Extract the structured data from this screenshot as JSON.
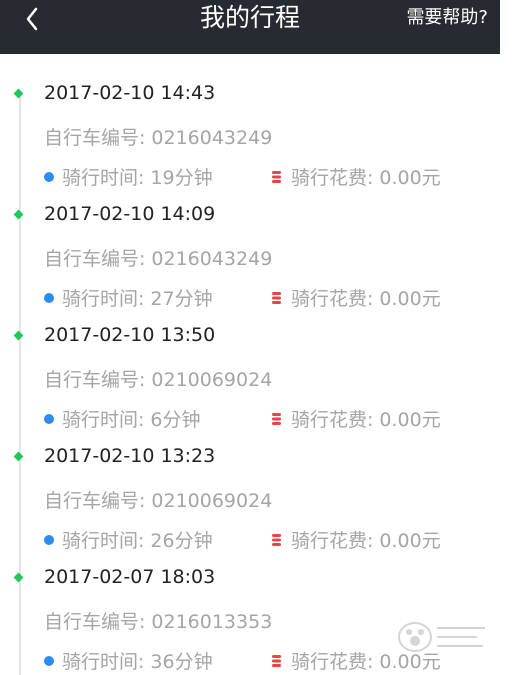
{
  "header": {
    "title": "我的行程",
    "help_label": "需要帮助?",
    "back_icon": "chevron-left-icon"
  },
  "colors": {
    "header_bg": "#262b31",
    "timeline_dot": "#22c55e",
    "duration_icon": "#2d8cf0",
    "cost_icon": "#e64545",
    "secondary_text": "#a5a5a5"
  },
  "labels": {
    "bike_no": "自行车编号:",
    "duration": "骑行时间:",
    "cost": "骑行花费:"
  },
  "trips": [
    {
      "datetime": "2017-02-10 14:43",
      "bike_id": "0216043249",
      "duration": "19分钟",
      "cost": "0.00元"
    },
    {
      "datetime": "2017-02-10 14:09",
      "bike_id": "0216043249",
      "duration": "27分钟",
      "cost": "0.00元"
    },
    {
      "datetime": "2017-02-10 13:50",
      "bike_id": "0210069024",
      "duration": "6分钟",
      "cost": "0.00元"
    },
    {
      "datetime": "2017-02-10 13:23",
      "bike_id": "0210069024",
      "duration": "26分钟",
      "cost": "0.00元"
    },
    {
      "datetime": "2017-02-07 18:03",
      "bike_id": "0216013353",
      "duration": "36分钟",
      "cost": "0.00元"
    }
  ]
}
